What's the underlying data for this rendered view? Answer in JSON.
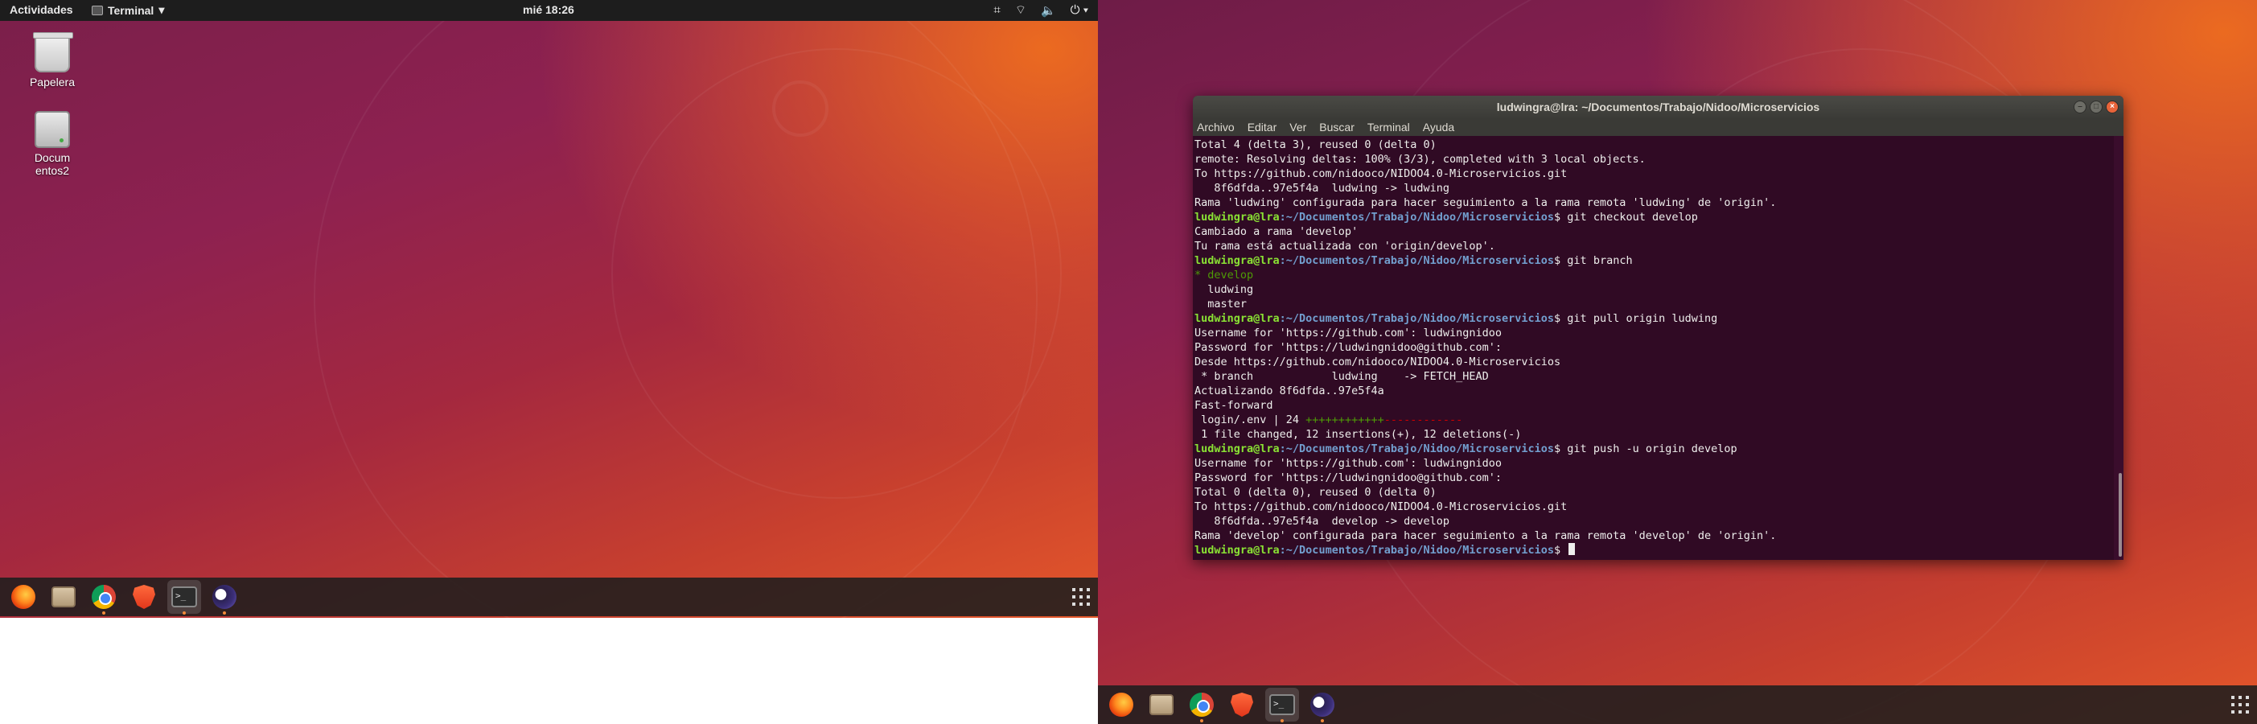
{
  "topbar": {
    "activities": "Actividades",
    "app_name": "Terminal",
    "clock": "mié 18:26"
  },
  "desktop_icons": [
    {
      "label": "Papelera",
      "icon": "trash-icon"
    },
    {
      "label": "Documentos2",
      "icon": "drive-icon"
    }
  ],
  "dock_apps": [
    "firefox-icon",
    "files-icon",
    "chrome-icon",
    "brave-icon",
    "terminal-icon",
    "eclipse-icon"
  ],
  "terminal": {
    "title": "ludwingra@lra: ~/Documentos/Trabajo/Nidoo/Microservicios",
    "menu": [
      "Archivo",
      "Editar",
      "Ver",
      "Buscar",
      "Terminal",
      "Ayuda"
    ],
    "prompt_user": "ludwingra@lra",
    "prompt_path": ":~/Documentos/Trabajo/Nidoo/Microservicios",
    "prompt_sign": "$ ",
    "lines": [
      {
        "kind": "out",
        "text": "Total 4 (delta 3), reused 0 (delta 0)"
      },
      {
        "kind": "out",
        "text": "remote: Resolving deltas: 100% (3/3), completed with 3 local objects."
      },
      {
        "kind": "out",
        "text": "To https://github.com/nidooco/NIDOO4.0-Microservicios.git"
      },
      {
        "kind": "out",
        "text": "   8f6dfda..97e5f4a  ludwing -> ludwing"
      },
      {
        "kind": "out",
        "text": "Rama 'ludwing' configurada para hacer seguimiento a la rama remota 'ludwing' de 'origin'."
      },
      {
        "kind": "cmd",
        "text": "git checkout develop"
      },
      {
        "kind": "out",
        "text": "Cambiado a rama 'develop'"
      },
      {
        "kind": "out",
        "text": "Tu rama está actualizada con 'origin/develop'."
      },
      {
        "kind": "cmd",
        "text": "git branch"
      },
      {
        "kind": "green",
        "text": "* develop"
      },
      {
        "kind": "out",
        "text": "  ludwing"
      },
      {
        "kind": "out",
        "text": "  master"
      },
      {
        "kind": "cmd",
        "text": "git pull origin ludwing"
      },
      {
        "kind": "out",
        "text": "Username for 'https://github.com': ludwingnidoo"
      },
      {
        "kind": "out",
        "text": "Password for 'https://ludwingnidoo@github.com':"
      },
      {
        "kind": "out",
        "text": "Desde https://github.com/nidooco/NIDOO4.0-Microservicios"
      },
      {
        "kind": "out",
        "text": " * branch            ludwing    -> FETCH_HEAD"
      },
      {
        "kind": "out",
        "text": "Actualizando 8f6dfda..97e5f4a"
      },
      {
        "kind": "out",
        "text": "Fast-forward"
      },
      {
        "kind": "diffstat",
        "text": " login/.env | 24 ",
        "plus": "++++++++++++",
        "minus": "------------"
      },
      {
        "kind": "out",
        "text": " 1 file changed, 12 insertions(+), 12 deletions(-)"
      },
      {
        "kind": "cmd",
        "text": "git push -u origin develop"
      },
      {
        "kind": "out",
        "text": "Username for 'https://github.com': ludwingnidoo"
      },
      {
        "kind": "out",
        "text": "Password for 'https://ludwingnidoo@github.com':"
      },
      {
        "kind": "out",
        "text": "Total 0 (delta 0), reused 0 (delta 0)"
      },
      {
        "kind": "out",
        "text": "To https://github.com/nidooco/NIDOO4.0-Microservicios.git"
      },
      {
        "kind": "out",
        "text": "   8f6dfda..97e5f4a  develop -> develop"
      },
      {
        "kind": "out",
        "text": "Rama 'develop' configurada para hacer seguimiento a la rama remota 'develop' de 'origin'."
      },
      {
        "kind": "prompt",
        "text": ""
      }
    ]
  },
  "colors": {
    "terminal_bg": "#300a24",
    "prompt_user": "#8ae234",
    "prompt_path": "#729fcf",
    "dock_active_dot": "#f28a3a"
  }
}
